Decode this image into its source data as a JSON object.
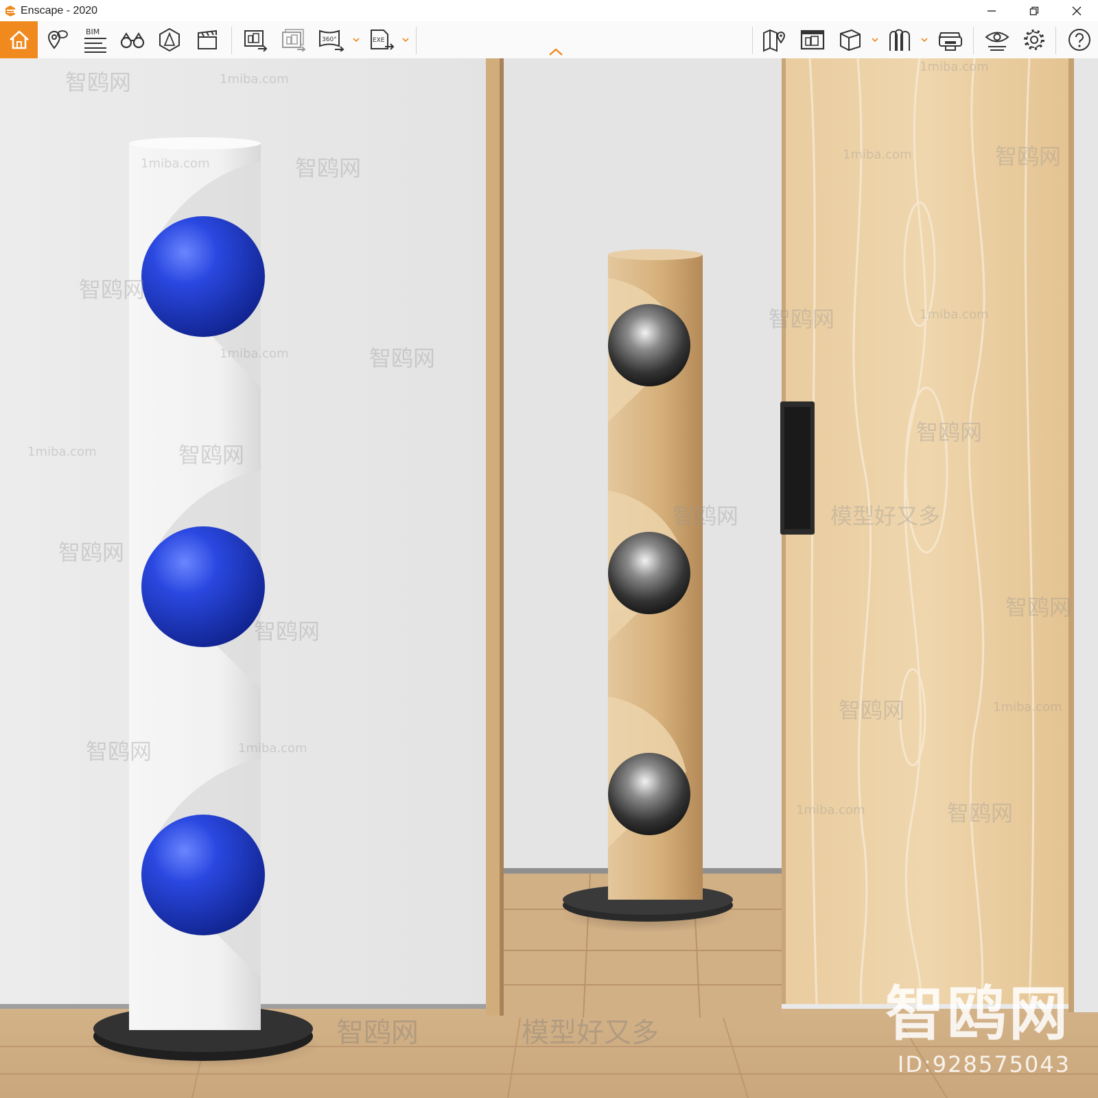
{
  "window": {
    "title": "Enscape - 2020",
    "controls": [
      "minimize-icon",
      "restore-icon",
      "close-icon"
    ]
  },
  "toolbar": {
    "accent_color": "#f0891e",
    "bim_label": "BIM",
    "panorama_label": "360°",
    "exe_label": "EXE",
    "left_tools": [
      "home-icon",
      "location-pin-icon",
      "bim-list-icon",
      "binoculars-icon",
      "object-placement-icon",
      "clapperboard-icon",
      "screenshot-export-icon",
      "batch-render-icon",
      "panorama-export-icon",
      "exe-export-icon"
    ],
    "right_tools": [
      "map-view-icon",
      "views-manager-icon",
      "cube-icon",
      "asset-library-icon",
      "vr-headset-icon",
      "visual-settings-icon",
      "gear-icon",
      "help-icon"
    ]
  },
  "watermark": {
    "site": "1miba.com",
    "brand": "智鸥网",
    "slogan": "模型好又多",
    "big_brand": "智鸥网",
    "id_text": "ID:928575043"
  },
  "scene": {
    "wall_color": "#e8e8e8",
    "floor_color": "#d9b88e",
    "door_color": "#e8c99a",
    "white_lamp_orb_color": "#1f3fd6",
    "wood_lamp_orb_color": "#3a3a3a"
  }
}
